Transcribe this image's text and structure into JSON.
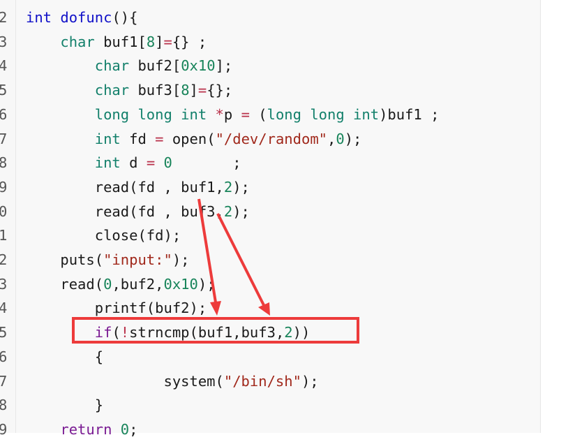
{
  "lines": [
    {
      "num": "2",
      "segs": [
        {
          "t": "int",
          "c": "k-blue"
        },
        {
          "t": " "
        },
        {
          "t": "dofunc",
          "c": "k-blue"
        },
        {
          "t": "(){"
        }
      ]
    },
    {
      "num": "3",
      "segs": [
        {
          "t": "    "
        },
        {
          "t": "char",
          "c": "k-green"
        },
        {
          "t": " buf1["
        },
        {
          "t": "8",
          "c": "num"
        },
        {
          "t": "]"
        },
        {
          "t": "=",
          "c": "op"
        },
        {
          "t": "{} ;"
        }
      ]
    },
    {
      "num": "4",
      "segs": [
        {
          "t": "        "
        },
        {
          "t": "char",
          "c": "k-green"
        },
        {
          "t": " buf2["
        },
        {
          "t": "0x10",
          "c": "num"
        },
        {
          "t": "];"
        }
      ]
    },
    {
      "num": "5",
      "segs": [
        {
          "t": "        "
        },
        {
          "t": "char",
          "c": "k-green"
        },
        {
          "t": " buf3["
        },
        {
          "t": "8",
          "c": "num"
        },
        {
          "t": "]"
        },
        {
          "t": "=",
          "c": "op"
        },
        {
          "t": "{};"
        }
      ]
    },
    {
      "num": "6",
      "segs": [
        {
          "t": "        "
        },
        {
          "t": "long long int",
          "c": "k-green"
        },
        {
          "t": " "
        },
        {
          "t": "*",
          "c": "op"
        },
        {
          "t": "p "
        },
        {
          "t": "=",
          "c": "op"
        },
        {
          "t": " ("
        },
        {
          "t": "long long int",
          "c": "k-green"
        },
        {
          "t": ")buf1 ;"
        }
      ]
    },
    {
      "num": "7",
      "segs": [
        {
          "t": "        "
        },
        {
          "t": "int",
          "c": "k-green"
        },
        {
          "t": " fd "
        },
        {
          "t": "=",
          "c": "op"
        },
        {
          "t": " open("
        },
        {
          "t": "\"/dev/random\"",
          "c": "str"
        },
        {
          "t": ","
        },
        {
          "t": "0",
          "c": "num"
        },
        {
          "t": ");"
        }
      ]
    },
    {
      "num": "8",
      "segs": [
        {
          "t": "        "
        },
        {
          "t": "int",
          "c": "k-green"
        },
        {
          "t": " d "
        },
        {
          "t": "=",
          "c": "op"
        },
        {
          "t": " "
        },
        {
          "t": "0",
          "c": "num"
        },
        {
          "t": "       ;"
        }
      ]
    },
    {
      "num": "9",
      "segs": [
        {
          "t": "        read(fd , buf1,"
        },
        {
          "t": "2",
          "c": "num"
        },
        {
          "t": ");"
        }
      ]
    },
    {
      "num": "0",
      "segs": [
        {
          "t": "        read(fd , buf3,"
        },
        {
          "t": "2",
          "c": "num"
        },
        {
          "t": ");"
        }
      ]
    },
    {
      "num": "1",
      "segs": [
        {
          "t": "        close(fd);"
        }
      ]
    },
    {
      "num": "2",
      "segs": [
        {
          "t": "    puts("
        },
        {
          "t": "\"input:\"",
          "c": "str"
        },
        {
          "t": ");"
        }
      ]
    },
    {
      "num": "3",
      "segs": [
        {
          "t": "    read("
        },
        {
          "t": "0",
          "c": "num"
        },
        {
          "t": ",buf2,"
        },
        {
          "t": "0x10",
          "c": "num"
        },
        {
          "t": ");"
        }
      ]
    },
    {
      "num": "4",
      "segs": [
        {
          "t": "        printf(buf2);"
        }
      ]
    },
    {
      "num": "5",
      "segs": [
        {
          "t": "        "
        },
        {
          "t": "if",
          "c": "k-purple"
        },
        {
          "t": "("
        },
        {
          "t": "!",
          "c": "op"
        },
        {
          "t": "strncmp(buf1,buf3,"
        },
        {
          "t": "2",
          "c": "num"
        },
        {
          "t": "))"
        }
      ]
    },
    {
      "num": "6",
      "segs": [
        {
          "t": "        {"
        }
      ]
    },
    {
      "num": "7",
      "segs": [
        {
          "t": "                system("
        },
        {
          "t": "\"/bin/sh\"",
          "c": "str"
        },
        {
          "t": ");"
        }
      ]
    },
    {
      "num": "8",
      "segs": [
        {
          "t": "        }"
        }
      ]
    },
    {
      "num": "9",
      "segs": [
        {
          "t": "    "
        },
        {
          "t": "return",
          "c": "k-purple"
        },
        {
          "t": " "
        },
        {
          "t": "0",
          "c": "num"
        },
        {
          "t": ";"
        }
      ]
    }
  ],
  "colors": {
    "highlight": "#ed3b3b",
    "keyword_type": "#13806b",
    "keyword_control": "#7a1b93",
    "string": "#a0281b",
    "number": "#18845a"
  }
}
